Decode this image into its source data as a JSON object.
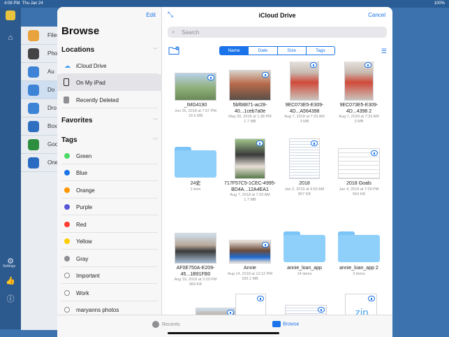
{
  "status": {
    "time": "4:08 PM",
    "date": "Thu Jan 24",
    "battery": "100%"
  },
  "background_app": {
    "rows": [
      {
        "label": "Files",
        "color": "#e8a33d"
      },
      {
        "label": "Pho",
        "color": "#444444"
      },
      {
        "label": "Au",
        "color": "#3d83d6"
      },
      {
        "label": "Do",
        "color": "#3d83d6"
      },
      {
        "label": "Dro",
        "color": "#3d83d6"
      },
      {
        "label": "Box",
        "color": "#2f6fc2"
      },
      {
        "label": "Goo",
        "color": "#2d8f3e"
      },
      {
        "label": "One",
        "color": "#2a6bc2"
      }
    ],
    "settings_label": "Settings"
  },
  "sidebar": {
    "edit_label": "Edit",
    "title": "Browse",
    "locations_header": "Locations",
    "locations": [
      {
        "label": "iCloud Drive",
        "icon": "cloud-icon"
      },
      {
        "label": "On My iPad",
        "icon": "ipad-icon"
      },
      {
        "label": "Recently Deleted",
        "icon": "trash-icon"
      }
    ],
    "favorites_header": "Favorites",
    "tags_header": "Tags",
    "tags": [
      {
        "label": "Green",
        "color": "#4cd964"
      },
      {
        "label": "Blue",
        "color": "#1a73e8"
      },
      {
        "label": "Orange",
        "color": "#ff9500"
      },
      {
        "label": "Purple",
        "color": "#5856d6"
      },
      {
        "label": "Red",
        "color": "#ff3b30"
      },
      {
        "label": "Yellow",
        "color": "#ffcc00"
      },
      {
        "label": "Gray",
        "color": "#8e8e93"
      },
      {
        "label": "Important",
        "color": ""
      },
      {
        "label": "Work",
        "color": ""
      },
      {
        "label": "maryanns photos",
        "color": ""
      }
    ]
  },
  "main": {
    "title": "iCloud Drive",
    "cancel_label": "Cancel",
    "search_placeholder": "Search",
    "sort_options": [
      "Name",
      "Date",
      "Size",
      "Tags"
    ],
    "selected_sort": "Name",
    "files": [
      {
        "name": "_IMG4190",
        "meta": [
          "Jun 25, 2018 at 7:57 PM",
          "19.5 MB"
        ]
      },
      {
        "name": "5bf68871-ac28-40...1ceb7a0e",
        "meta": [
          "May 30, 2018 at 1:38 PM",
          "1.7 MB"
        ]
      },
      {
        "name": "9EC073E5-E309-4D...A564398",
        "meta": [
          "Aug 7, 2018 at 7:33 AM",
          "3 MB"
        ]
      },
      {
        "name": "9EC073E5-E309-4D...4398 2",
        "meta": [
          "Aug 7, 2018 at 7:33 AM",
          "3 MB"
        ]
      },
      {
        "name": "24史",
        "meta": [
          "1 item"
        ]
      },
      {
        "name": "717F57C5-1CEC-4995-BD4A...12A4EA1",
        "meta": [
          "Aug 7, 2018 at 7:33 AM",
          "1.7 MB"
        ]
      },
      {
        "name": "2018",
        "meta": [
          "Jan 2, 2019 at 9:50 AM",
          "807 KB"
        ]
      },
      {
        "name": "2018 Goals",
        "meta": [
          "Jan 4, 2019 at 7:29 PM",
          "564 KB"
        ]
      },
      {
        "name": "AF0E750A-E209-45...1B91FB0",
        "meta": [
          "Aug 10, 2018 at 3:33 PM",
          "969 KB"
        ]
      },
      {
        "name": "Annie",
        "meta": [
          "Aug 14, 2018 at 12:12 PM",
          "183.1 MB"
        ]
      },
      {
        "name": "annie_loan_app",
        "meta": [
          "14 items"
        ]
      },
      {
        "name": "annie_loan_app 2",
        "meta": [
          "3 items"
        ]
      },
      {
        "name": "",
        "meta": []
      },
      {
        "name": "",
        "meta": []
      },
      {
        "name": "",
        "meta": []
      },
      {
        "name": "zip",
        "meta": []
      }
    ]
  },
  "tabbar": {
    "recents_label": "Recents",
    "browse_label": "Browse"
  },
  "colors": {
    "accent": "#1a73e8",
    "folder": "#8fd0fb"
  }
}
